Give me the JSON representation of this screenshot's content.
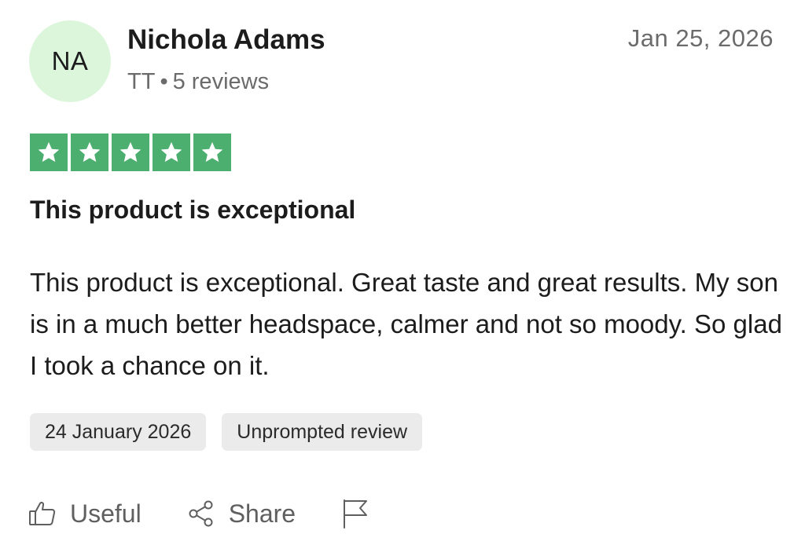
{
  "reviewer": {
    "initials": "NA",
    "name": "Nichola Adams",
    "country": "TT",
    "separator": "•",
    "review_count": "5 reviews",
    "avatar_color": "#dcf6dc"
  },
  "review": {
    "date": "Jan 25, 2026",
    "rating": 5,
    "rating_max": 5,
    "star_color": "#4caf70",
    "title": "This product is exceptional",
    "text": "This product is exceptional. Great taste and great results. My son is in a much better headspace, calmer and not so moody. So glad I took a chance on it.",
    "tags": {
      "experience_date": "24 January 2026",
      "review_type": "Unprompted review"
    }
  },
  "actions": {
    "useful_label": "Useful",
    "useful_icon": "thumbs-up-icon",
    "share_label": "Share",
    "share_icon": "share-icon",
    "report_icon": "flag-icon"
  }
}
